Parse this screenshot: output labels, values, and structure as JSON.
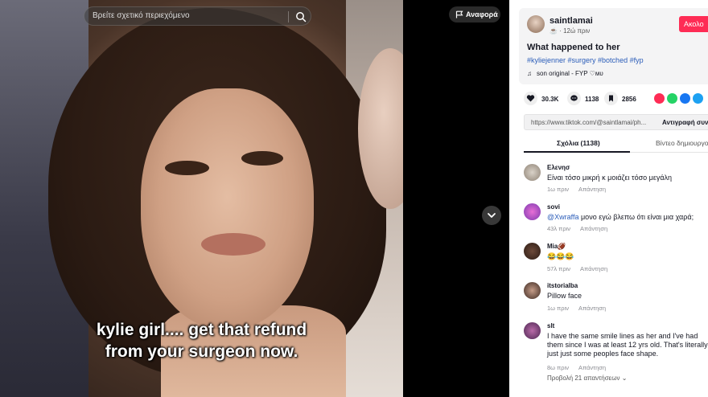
{
  "search": {
    "placeholder": "Βρείτε σχετικό περιεχόμενο"
  },
  "report": {
    "label": "Αναφορά"
  },
  "video": {
    "caption_line1": "kylie girl.... get that refund",
    "caption_line2": "from your surgeon now."
  },
  "author": {
    "username": "saintlamai",
    "meta": "☕ · 12ώ πριν",
    "follow_label": "Ακολο"
  },
  "post": {
    "title": "What happened to her",
    "hashtags": "#kyliejenner #surgery #botched #fyp",
    "sound": "son original - FYP ♡мυ"
  },
  "actions": {
    "likes": "30.3K",
    "comments": "1138",
    "saves": "2856"
  },
  "share_colors": {
    "report": "#fe2c55",
    "whatsapp": "#25d366",
    "facebook": "#1877f2",
    "twitter": "#1da1f2"
  },
  "link": {
    "url": "https://www.tiktok.com/@saintlamai/ph...",
    "copy_label": "Αντιγραφή συνδ"
  },
  "tabs": {
    "comments": "Σχόλια (1138)",
    "creator": "Βίντεο δημιουργού"
  },
  "comments": [
    {
      "name": "Ελενησ",
      "text": "Είναι τόσο μικρή κ μοιάζει τόσο μεγάλη",
      "time": "1ω πριν",
      "reply": "Απάντηση"
    },
    {
      "name": "sovi",
      "mention": "@Xwraffa",
      "text": " μονο εγώ βλεπω ότι είναι μια χαρά;",
      "time": "43λ πριν",
      "reply": "Απάντηση"
    },
    {
      "name": "Mia🏈",
      "text": "😂😂😂",
      "time": "57λ πριν",
      "reply": "Απάντηση"
    },
    {
      "name": "itstorialba",
      "text": "Pillow face",
      "time": "1ω πριν",
      "reply": "Απάντηση"
    },
    {
      "name": "slt",
      "text": "I have the same smile lines as her and I've had them since I was at least 12 yrs old. That's literally just just some peoples face shape.",
      "time": "8ω πριν",
      "reply": "Απάντηση"
    }
  ],
  "more_replies": "Προβολή 21 απαντήσεων ⌄"
}
